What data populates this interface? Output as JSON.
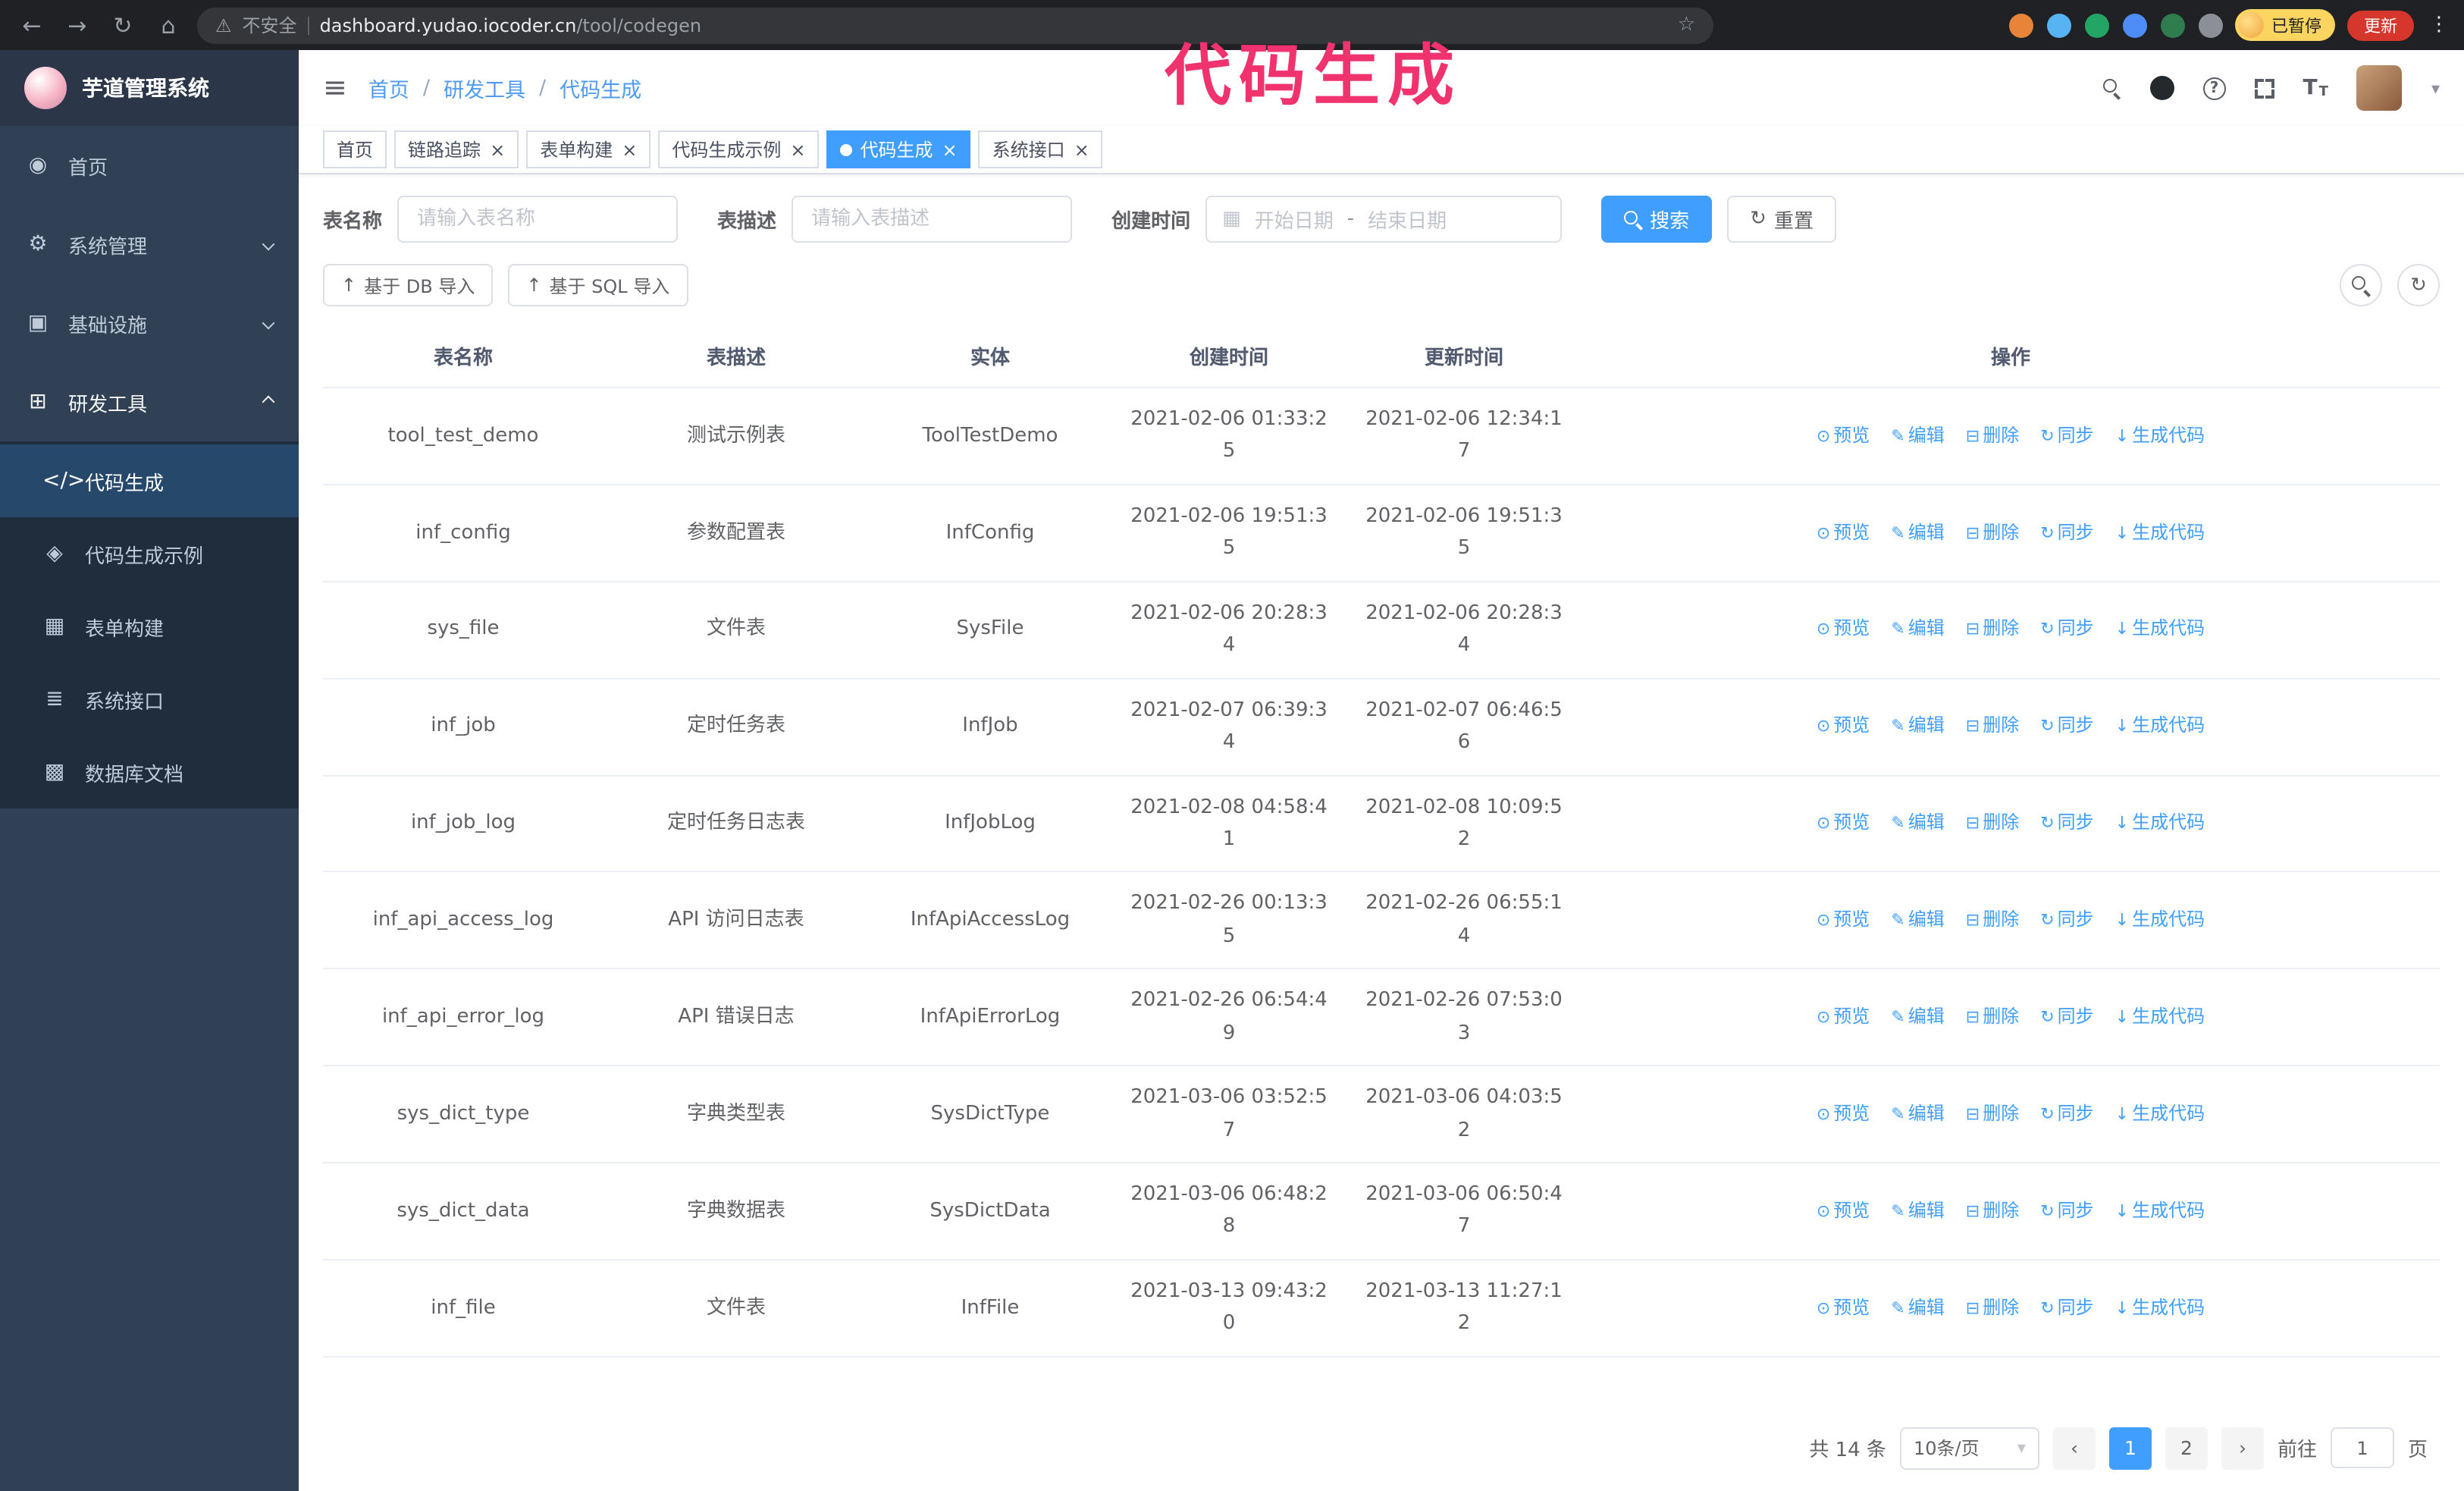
{
  "chrome": {
    "security_label": "不安全",
    "url_host": "dashboard.yudao.iocoder.cn",
    "url_path": "/tool/codegen",
    "paused_badge": "已暂停",
    "update_label": "更新",
    "extensions": [
      {
        "key": "extension-orange",
        "color": "#e8833a"
      },
      {
        "key": "extension-lightblue",
        "color": "#57b3f2"
      },
      {
        "key": "extension-green",
        "color": "#23a566"
      },
      {
        "key": "extension-blue",
        "color": "#4e8cf7"
      },
      {
        "key": "extension-darkgreen",
        "color": "#2f7d4f"
      },
      {
        "key": "extension-gray",
        "color": "#8a8f98"
      }
    ]
  },
  "icons": {
    "back": "←",
    "forward": "→",
    "reload": "↻",
    "home": "⌂",
    "warning": "⚠",
    "star": "☆",
    "kebab": "⋮",
    "hamburger": "≡",
    "question": "?",
    "caret_down": "▾",
    "calendar": "▦",
    "refresh": "↻",
    "upload": "↑",
    "prev": "‹",
    "next": "›",
    "close": "×",
    "font_large": "T",
    "font_small": "T"
  },
  "annotation": {
    "text": "代码生成",
    "color": "#f0336f"
  },
  "sidebar": {
    "title": "芋道管理系统",
    "menu": [
      {
        "key": "home",
        "label": "首页",
        "icon": "◉"
      },
      {
        "key": "system",
        "label": "系统管理",
        "icon": "⚙",
        "arrow": "down"
      },
      {
        "key": "infra",
        "label": "基础设施",
        "icon": "▣",
        "arrow": "down"
      },
      {
        "key": "devtools",
        "label": "研发工具",
        "icon": "⊞",
        "arrow": "up",
        "active": true
      }
    ],
    "submenu": [
      {
        "key": "codegen",
        "label": "代码生成",
        "icon": "</>",
        "active": true
      },
      {
        "key": "codegen-example",
        "label": "代码生成示例",
        "icon": "◈"
      },
      {
        "key": "form-builder",
        "label": "表单构建",
        "icon": "▦"
      },
      {
        "key": "api",
        "label": "系统接口",
        "icon": "≣"
      },
      {
        "key": "db-doc",
        "label": "数据库文档",
        "icon": "▩"
      }
    ]
  },
  "navbar": {
    "breadcrumb": [
      "首页",
      "研发工具",
      "代码生成"
    ],
    "separator": "/"
  },
  "tabs": [
    {
      "key": "home",
      "label": "首页",
      "closable": false
    },
    {
      "key": "tracer",
      "label": "链路追踪",
      "closable": true
    },
    {
      "key": "form-builder",
      "label": "表单构建",
      "closable": true
    },
    {
      "key": "codegen-example",
      "label": "代码生成示例",
      "closable": true
    },
    {
      "key": "codegen",
      "label": "代码生成",
      "closable": true,
      "active": true
    },
    {
      "key": "api",
      "label": "系统接口",
      "closable": true
    }
  ],
  "filters": {
    "table_name_label": "表名称",
    "table_name_placeholder": "请输入表名称",
    "table_desc_label": "表描述",
    "table_desc_placeholder": "请输入表描述",
    "create_time_label": "创建时间",
    "date_start_placeholder": "开始日期",
    "date_separator": "-",
    "date_end_placeholder": "结束日期",
    "search_button": "搜索",
    "reset_button": "重置"
  },
  "toolbar": {
    "import_db": "基于 DB 导入",
    "import_sql": "基于 SQL 导入"
  },
  "table": {
    "columns": [
      "表名称",
      "表描述",
      "实体",
      "创建时间",
      "更新时间",
      "操作"
    ],
    "actions": [
      {
        "key": "preview",
        "label": "预览",
        "icon": "⊙"
      },
      {
        "key": "edit",
        "label": "编辑",
        "icon": "✎"
      },
      {
        "key": "delete",
        "label": "删除",
        "icon": "⊟"
      },
      {
        "key": "sync",
        "label": "同步",
        "icon": "↻"
      },
      {
        "key": "generate",
        "label": "生成代码",
        "icon": "↓"
      }
    ],
    "rows": [
      {
        "name": "tool_test_demo",
        "desc": "测试示例表",
        "entity": "ToolTestDemo",
        "created": "2021-02-06 01:33:25",
        "updated": "2021-02-06 12:34:17"
      },
      {
        "name": "inf_config",
        "desc": "参数配置表",
        "entity": "InfConfig",
        "created": "2021-02-06 19:51:35",
        "updated": "2021-02-06 19:51:35"
      },
      {
        "name": "sys_file",
        "desc": "文件表",
        "entity": "SysFile",
        "created": "2021-02-06 20:28:34",
        "updated": "2021-02-06 20:28:34"
      },
      {
        "name": "inf_job",
        "desc": "定时任务表",
        "entity": "InfJob",
        "created": "2021-02-07 06:39:34",
        "updated": "2021-02-07 06:46:56"
      },
      {
        "name": "inf_job_log",
        "desc": "定时任务日志表",
        "entity": "InfJobLog",
        "created": "2021-02-08 04:58:41",
        "updated": "2021-02-08 10:09:52"
      },
      {
        "name": "inf_api_access_log",
        "desc": "API 访问日志表",
        "entity": "InfApiAccessLog",
        "created": "2021-02-26 00:13:35",
        "updated": "2021-02-26 06:55:14"
      },
      {
        "name": "inf_api_error_log",
        "desc": "API 错误日志",
        "entity": "InfApiErrorLog",
        "created": "2021-02-26 06:54:49",
        "updated": "2021-02-26 07:53:03"
      },
      {
        "name": "sys_dict_type",
        "desc": "字典类型表",
        "entity": "SysDictType",
        "created": "2021-03-06 03:52:57",
        "updated": "2021-03-06 04:03:52"
      },
      {
        "name": "sys_dict_data",
        "desc": "字典数据表",
        "entity": "SysDictData",
        "created": "2021-03-06 06:48:28",
        "updated": "2021-03-06 06:50:47"
      },
      {
        "name": "inf_file",
        "desc": "文件表",
        "entity": "InfFile",
        "created": "2021-03-13 09:43:20",
        "updated": "2021-03-13 11:27:12"
      }
    ]
  },
  "pagination": {
    "total": "共 14 条",
    "page_size": "10条/页",
    "pages": [
      "1",
      "2"
    ],
    "active_page": "1",
    "goto_label": "前往",
    "goto_value": "1",
    "goto_unit": "页"
  }
}
